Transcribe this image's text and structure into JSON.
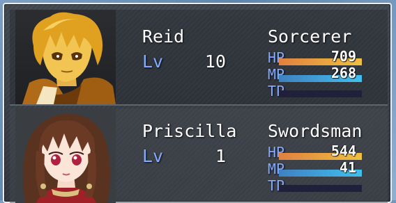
{
  "menu": {
    "actors": [
      {
        "name": "Reid",
        "class": "Sorcerer",
        "level_label": "Lv",
        "level": "10",
        "hp_label": "HP",
        "hp": "709",
        "hp_fraction": 1.0,
        "mp_label": "MP",
        "mp": "268",
        "mp_fraction": 1.0,
        "tp_label": "TP",
        "tp_fraction": 0.0,
        "face_icon": "blond-young-man-portrait"
      },
      {
        "name": "Priscilla",
        "class": "Swordsman",
        "level_label": "Lv",
        "level": "1",
        "hp_label": "HP",
        "hp": "544",
        "hp_fraction": 1.0,
        "mp_label": "MP",
        "mp": "41",
        "mp_fraction": 1.0,
        "tp_label": "TP",
        "tp_fraction": 0.0,
        "face_icon": "brown-haired-girl-portrait"
      }
    ],
    "colors": {
      "system_text": "#84aaff",
      "hp_gauge": "#f0a040",
      "mp_gauge": "#40a0e0",
      "gauge_back": "#20203a"
    }
  }
}
